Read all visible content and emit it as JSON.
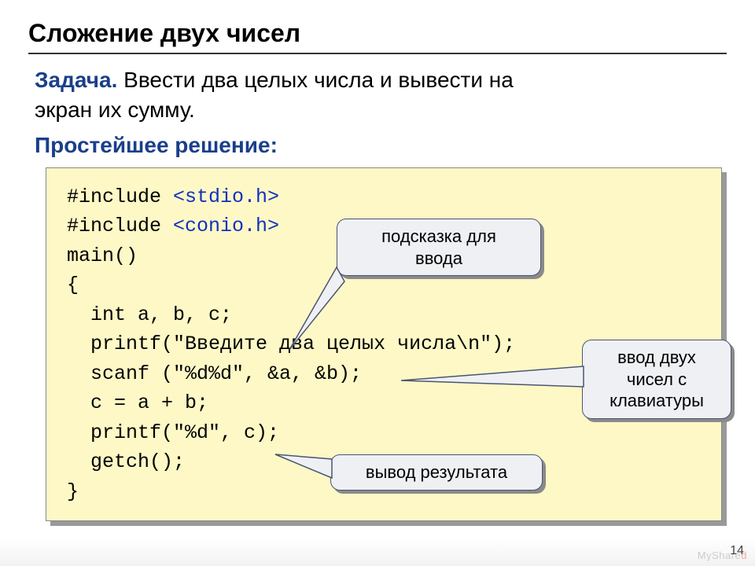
{
  "title": "Сложение двух чисел",
  "task": {
    "label": "Задача.",
    "text_line1": " Ввести два целых числа и вывести на",
    "text_line2": "экран их сумму."
  },
  "solution_label": "Простейшее решение:",
  "code": {
    "l1_a": "#include ",
    "l1_b": "<stdio.h>",
    "l2_a": "#include ",
    "l2_b": "<conio.h>",
    "l3": "main()",
    "l4": "{",
    "l5": "  int a, b, c;",
    "l6": "  printf(\"Введите два целых числа\\n\");",
    "l7": "  scanf (\"%d%d\", &a, &b);",
    "l8": "  c = a + b;",
    "l9": "  printf(\"%d\", c);",
    "l10": "  getch();",
    "l11": "}"
  },
  "callouts": {
    "hint": "подсказка для\nввода",
    "input": "ввод двух\nчисел с\nклавиатуры",
    "output": "вывод результата"
  },
  "page_number": "14",
  "watermark_prefix": "MyShare",
  "watermark_accent": "d"
}
